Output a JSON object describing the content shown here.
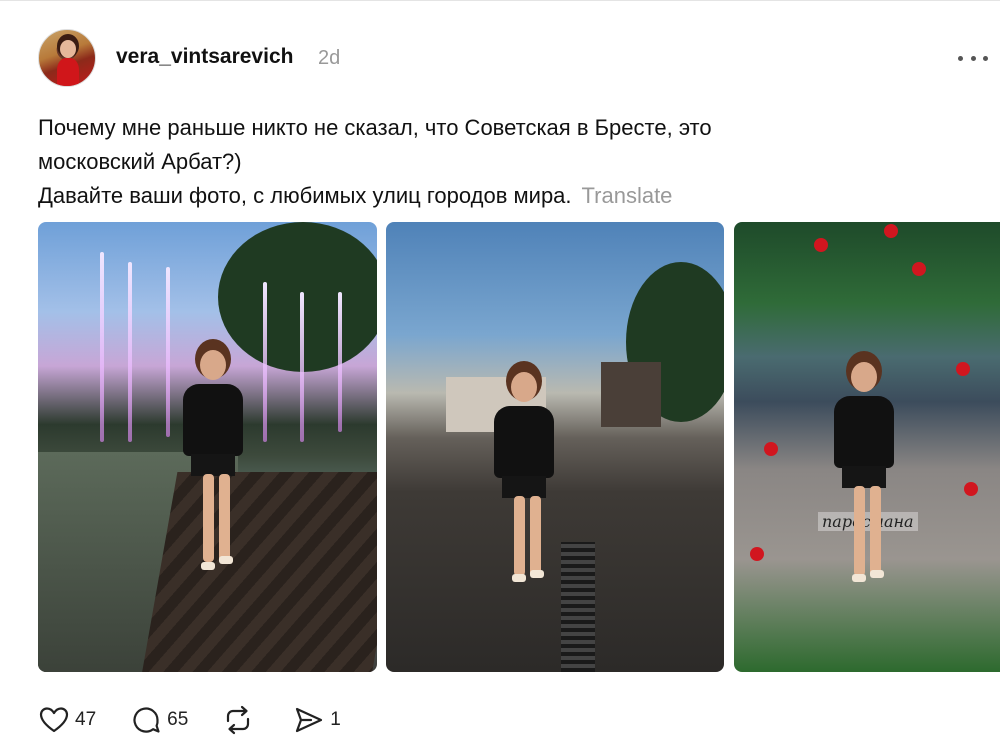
{
  "post": {
    "username": "vera_vintsarevich",
    "timestamp": "2d",
    "text_lines": [
      "Почему мне раньше никто не сказал, что Советская в Бресте, это",
      "московский Арбат?)",
      "Давайте ваши фото, с любимых улиц городов мира."
    ],
    "translate_label": "Translate",
    "photo3_logo_text": "паросмана"
  },
  "actions": {
    "like_count": "47",
    "comment_count": "65",
    "repost_count": "",
    "share_count": "1"
  },
  "icons": {
    "like": "heart-icon",
    "comment": "comment-bubble-icon",
    "repost": "repost-icon",
    "share": "send-icon",
    "more": "more-dots-icon"
  },
  "colors": {
    "text": "#111111",
    "muted": "#999999",
    "apple_red": "#d1161f"
  }
}
